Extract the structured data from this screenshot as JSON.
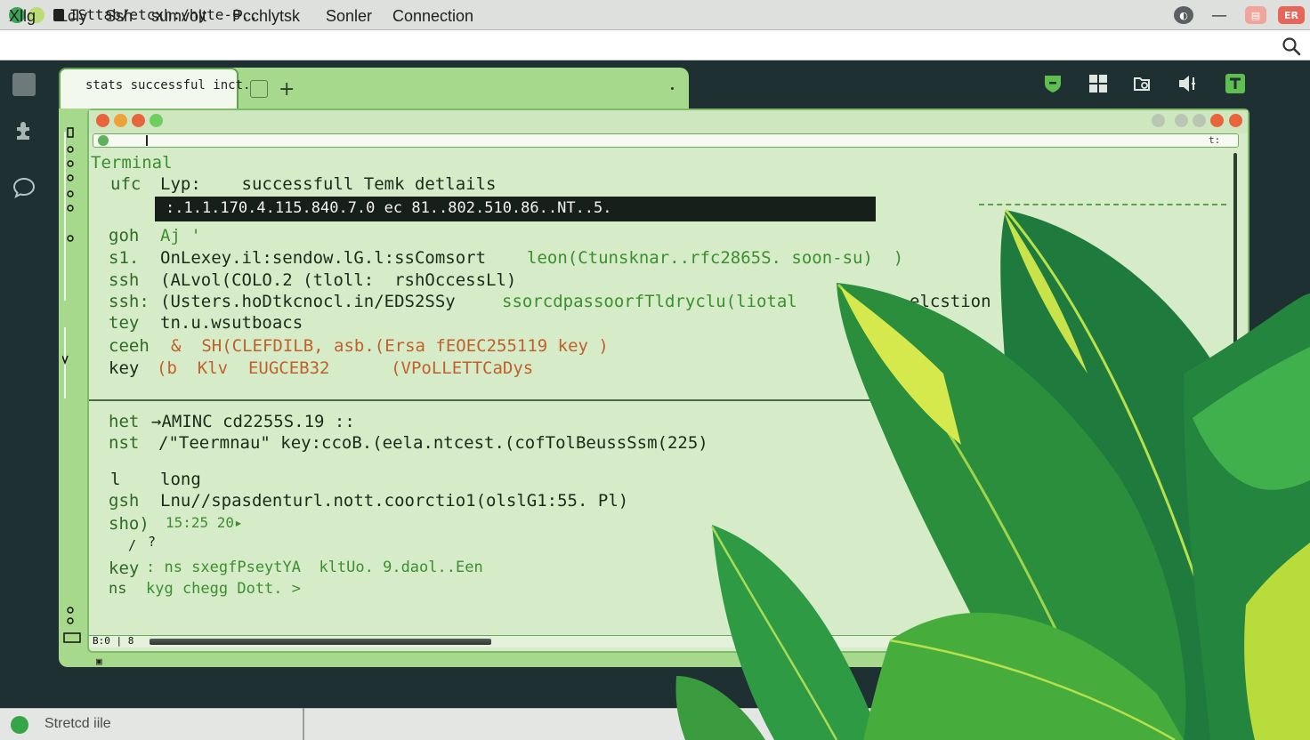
{
  "window": {
    "title": "ISttab/etcxh:/hyte-θ..",
    "controls": [
      "",
      "—",
      "",
      "ER"
    ]
  },
  "menu": {
    "items": [
      "Xllg",
      "Lcly",
      "Ssh",
      "sumvolt",
      "Pcchlytsk",
      "Sonler",
      "Connection"
    ]
  },
  "tabs": {
    "active_label": "stats successful inct.",
    "add_label": "+"
  },
  "address_bar": {
    "end_text": "t:"
  },
  "terminal": {
    "heading": "Terminal",
    "lines": [
      {
        "k": "ufc",
        "v": "Lyp:    successfull Temk detlails"
      },
      {
        "k": "",
        "v": ":.1.1.170.4.115.840.7.0 ec 81..802.510.86..NT..5."
      },
      {
        "k": "goh",
        "v": "Aj '"
      },
      {
        "k": "s1.",
        "v": "OnLexey.il:sendow.lG.l:ssComsort"
      },
      {
        "k": "ssh",
        "v": "(ALvol(COLO.2 (tloll:  rshOccessLl)"
      },
      {
        "k": "ssh:",
        "v": "(Usters.hoDtkcnocl.in/EDS2SSy"
      },
      {
        "k": "tey",
        "v": "tn.u.wsutboacs"
      },
      {
        "k": "ceeh",
        "v": "&  SH(CLEFDILB, asb.(Ersa fEOEC255119 key )"
      },
      {
        "k": "key",
        "v": "(b  Klv  EUGCEB32      (VPoLLETTCaDys"
      },
      {
        "k": "het",
        "v": "→AMINC cd2255S.19 ::"
      },
      {
        "k": "nst",
        "v": "/\"Teermnau\" key:ccoB.(eela.ntcest.(cofTolBeussSsm(225)"
      },
      {
        "k": "l",
        "v": "long"
      },
      {
        "k": "gsh",
        "v": "Lnu//spasdenturl.nott.coorctio1(olslG1:55. Pl)"
      },
      {
        "k": "sho)",
        "v": "15:25 20▸"
      },
      {
        "k": "/",
        "v": "?"
      },
      {
        "k": "key",
        "v": ": ns sxegfPseytYA  kltUo. 9.daol..Een"
      },
      {
        "k": "ns",
        "v": "kyg chegg Dott. >"
      }
    ],
    "fragments": {
      "soon_tail": "leon(Ctunsknar..rfc2865S. soon-su)  )",
      "sso_tail": "ssorcdpassoorfTldryclu(liotal",
      "right_tail": "elcstion"
    },
    "strip_label": "B:0 | 8"
  },
  "status": {
    "text": "Stretcd iile"
  },
  "colors": {
    "accent": "#a6d98c",
    "terminal_bg": "#d6ecc8",
    "highlight_bg": "#171f1b",
    "status_ok": "#36a548",
    "orange_text": "#c0602a"
  }
}
